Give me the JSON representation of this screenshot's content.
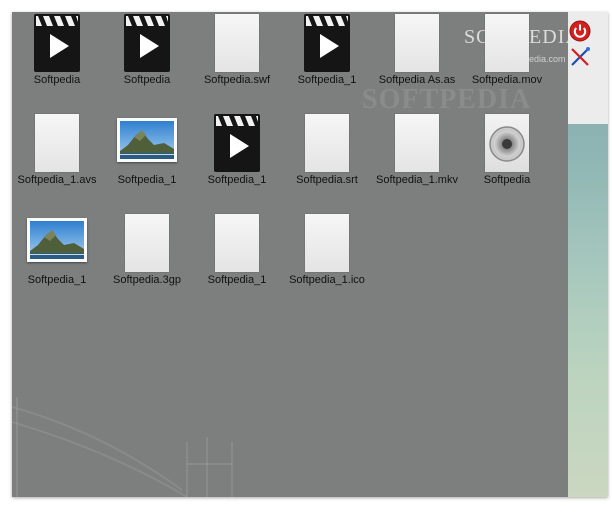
{
  "watermark": {
    "text": "SOFTPEDIA"
  },
  "logo": {
    "name": "SOFTPEDIA",
    "url": "www.softpedia.com"
  },
  "colors": {
    "desktop": "#7d7e7e",
    "label": "#111111",
    "accent": "#d21f1f"
  },
  "files": [
    {
      "label": "Softpedia",
      "icon": "video-clip-icon"
    },
    {
      "label": "Softpedia",
      "icon": "video-clip-icon"
    },
    {
      "label": "Softpedia.swf",
      "icon": "blank-document-icon"
    },
    {
      "label": "Softpedia_1",
      "icon": "video-clip-icon"
    },
    {
      "label": "Softpedia As.as",
      "icon": "blank-document-icon"
    },
    {
      "label": "Softpedia.mov",
      "icon": "blank-document-icon"
    },
    {
      "label": "Softpedia_1.avs",
      "icon": "blank-document-icon"
    },
    {
      "label": "Softpedia_1",
      "icon": "photo-icon"
    },
    {
      "label": "Softpedia_1",
      "icon": "video-clip-icon"
    },
    {
      "label": "Softpedia.srt",
      "icon": "blank-document-icon"
    },
    {
      "label": "Softpedia_1.mkv",
      "icon": "blank-document-icon"
    },
    {
      "label": "Softpedia",
      "icon": "speaker-icon"
    },
    {
      "label": "Softpedia_1",
      "icon": "photo-icon"
    },
    {
      "label": "Softpedia.3gp",
      "icon": "blank-document-icon"
    },
    {
      "label": "Softpedia_1",
      "icon": "blank-document-icon"
    },
    {
      "label": "Softpedia_1.ico",
      "icon": "blank-document-icon"
    }
  ],
  "sidebar": {
    "power_icon": "power-icon",
    "tools_icon": "tools-icon"
  }
}
